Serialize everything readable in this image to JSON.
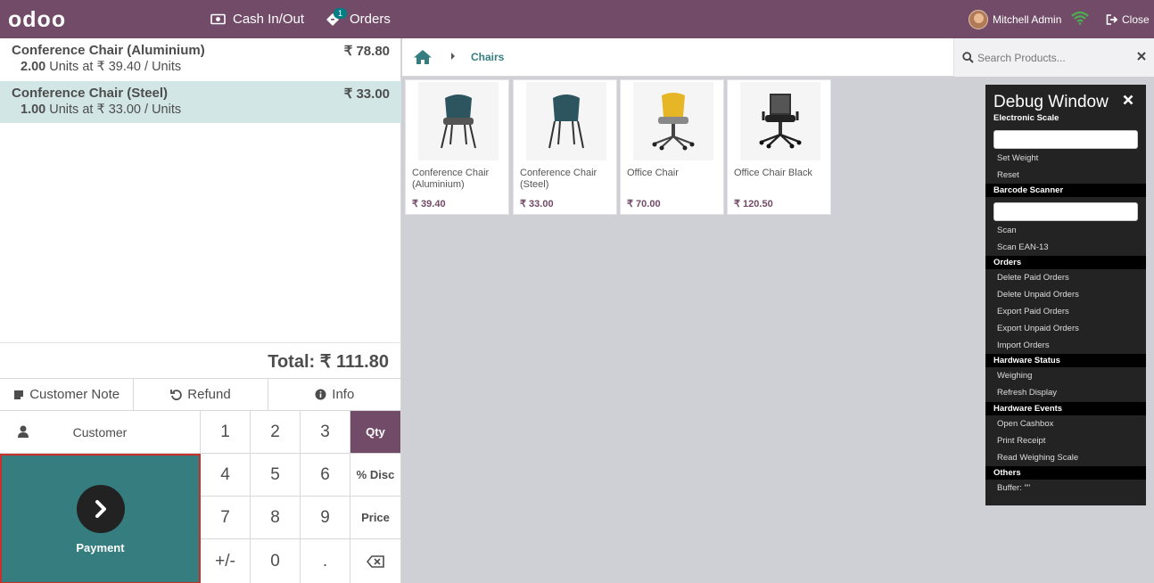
{
  "navbar": {
    "logo": "odoo",
    "cash_label": "Cash In/Out",
    "orders_label": "Orders",
    "orders_count": "1",
    "user_name": "Mitchell Admin",
    "close_label": "Close"
  },
  "order": {
    "lines": [
      {
        "name": "Conference Chair (Aluminium)",
        "price": "₹ 78.80",
        "qty": "2.00",
        "unit_info": "Units at ₹ 39.40 / Units"
      },
      {
        "name": "Conference Chair (Steel)",
        "price": "₹ 33.00",
        "qty": "1.00",
        "unit_info": "Units at ₹ 33.00 / Units"
      }
    ],
    "total": "Total: ₹ 111.80"
  },
  "controls": {
    "customer_note": "Customer Note",
    "refund": "Refund",
    "info": "Info"
  },
  "pad": {
    "customer": "Customer",
    "payment": "Payment",
    "keys": [
      "1",
      "2",
      "3",
      "Qty",
      "4",
      "5",
      "6",
      "% Disc",
      "7",
      "8",
      "9",
      "Price",
      "+/-",
      "0",
      "."
    ]
  },
  "breadcrumb": {
    "category": "Chairs"
  },
  "search": {
    "placeholder": "Search Products..."
  },
  "products": [
    {
      "name": "Conference Chair (Aluminium)",
      "price": "₹ 39.40"
    },
    {
      "name": "Conference Chair (Steel)",
      "price": "₹ 33.00"
    },
    {
      "name": "Office Chair",
      "price": "₹ 70.00"
    },
    {
      "name": "Office Chair Black",
      "price": "₹ 120.50"
    }
  ],
  "debug": {
    "title": "Debug Window",
    "sections": {
      "scale": "Electronic Scale",
      "barcode": "Barcode Scanner",
      "orders": "Orders",
      "hw_status": "Hardware Status",
      "hw_events": "Hardware Events",
      "others": "Others"
    },
    "items": {
      "set_weight": "Set Weight",
      "reset": "Reset",
      "scan": "Scan",
      "scan_ean": "Scan EAN-13",
      "delete_paid": "Delete Paid Orders",
      "delete_unpaid": "Delete Unpaid Orders",
      "export_paid": "Export Paid Orders",
      "export_unpaid": "Export Unpaid Orders",
      "import_orders": "Import Orders",
      "weighing": "Weighing",
      "refresh_display": "Refresh Display",
      "open_cashbox": "Open Cashbox",
      "print_receipt": "Print Receipt",
      "read_scale": "Read Weighing Scale",
      "buffer": "Buffer: \"\""
    }
  },
  "colors": {
    "brand": "#714b67",
    "accent": "#357d7f",
    "selected_line": "#d3e6e6"
  }
}
